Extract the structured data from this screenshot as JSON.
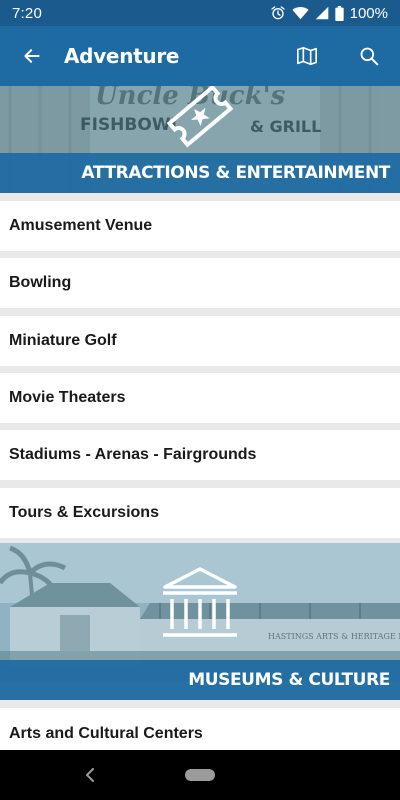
{
  "status_bar": {
    "time": "7:20",
    "battery": "100%",
    "icons": [
      "alarm-icon",
      "wifi-icon",
      "signal-icon",
      "battery-icon"
    ]
  },
  "app_bar": {
    "title": "Adventure",
    "actions": [
      "map-icon",
      "search-icon"
    ]
  },
  "sections": [
    {
      "title": "ATTRACTIONS & ENTERTAINMENT",
      "banner_sign_text": [
        "Uncle Buck's",
        "FISHBOWL",
        "& GRILL"
      ],
      "items": [
        {
          "label": "Amusement Venue"
        },
        {
          "label": "Bowling"
        },
        {
          "label": "Miniature Golf"
        },
        {
          "label": "Movie Theaters"
        },
        {
          "label": "Stadiums - Arenas - Fairgrounds"
        },
        {
          "label": "Tours & Excursions"
        }
      ]
    },
    {
      "title": "MUSEUMS & CULTURE",
      "banner_sign_text": [
        "HASTINGS ARTS & HERITAGE M"
      ],
      "items": [
        {
          "label": "Arts and Cultural Centers"
        }
      ]
    }
  ],
  "colors": {
    "status_bar": "#1a5a8c",
    "app_bar": "#1e6aa3",
    "caption_bar": "#1e6aa3",
    "background": "#e9e9e9",
    "row": "#ffffff"
  }
}
